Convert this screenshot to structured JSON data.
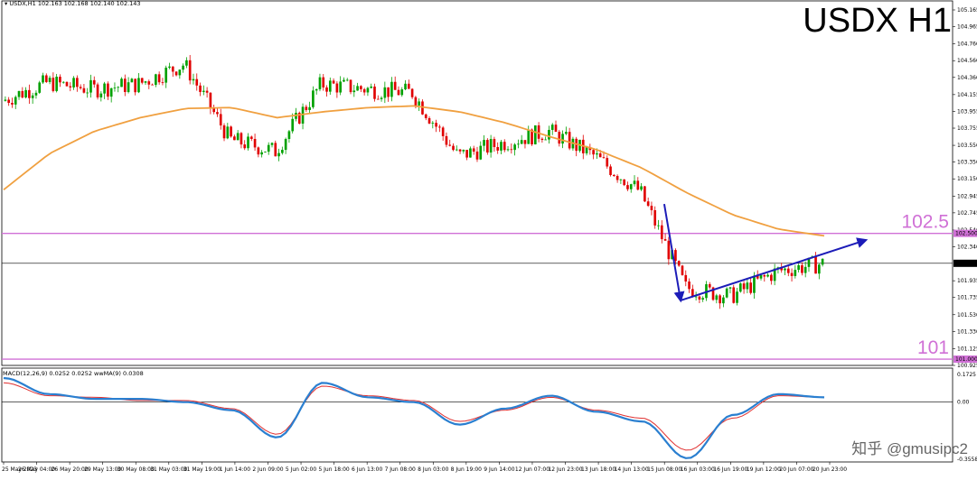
{
  "header": {
    "symbol_line": "USDX,H1  102.163 102.168 102.140 102.143",
    "macd_line": "MACD(12,26,9) 0.0252 0.0252  wwMA(9) 0.0308"
  },
  "title": "USDX H1",
  "watermark": "知乎 @gmusipc2",
  "price_axis": {
    "labels": [
      "105.165",
      "104.965",
      "104.760",
      "104.560",
      "104.360",
      "104.155",
      "103.955",
      "103.755",
      "103.550",
      "103.350",
      "103.150",
      "102.945",
      "102.745",
      "102.540",
      "102.340",
      "101.935",
      "101.735",
      "101.530",
      "101.330",
      "101.125",
      "100.925"
    ],
    "current_price": "102.143",
    "level_tags": [
      "102.500",
      "101.000"
    ]
  },
  "macd_axis": {
    "labels": [
      "0.1725",
      "0.00",
      "-0.3558"
    ]
  },
  "time_axis": [
    "25 May 2023",
    "26 May 04:00",
    "26 May 20:00",
    "29 May 13:00",
    "30 May 08:00",
    "31 May 03:00",
    "31 May 19:00",
    "1 Jun 14:00",
    "2 Jun 09:00",
    "5 Jun 02:00",
    "5 Jun 18:00",
    "6 Jun 13:00",
    "7 Jun 08:00",
    "8 Jun 03:00",
    "8 Jun 19:00",
    "9 Jun 14:00",
    "12 Jun 07:00",
    "12 Jun 23:00",
    "13 Jun 18:00",
    "14 Jun 13:00",
    "15 Jun 08:00",
    "16 Jun 03:00",
    "16 Jun 19:00",
    "19 Jun 12:00",
    "20 Jun 07:00",
    "20 Jun 23:00"
  ],
  "levels": [
    {
      "label": "102.5",
      "price": 102.5
    },
    {
      "label": "101",
      "price": 101.0
    }
  ],
  "colors": {
    "bull": "#00a000",
    "bear": "#e00000",
    "ma": "#f0a040",
    "level": "#d070d6",
    "arrow": "#1c1cb8",
    "macd": "#2a7fd0",
    "signal": "#e03030"
  },
  "chart_data": {
    "type": "line",
    "title": "USDX H1",
    "series": [
      {
        "name": "USDX,H1",
        "x": [
          "25 May",
          "26 May",
          "29 May",
          "30 May",
          "31 May",
          "1 Jun",
          "2 Jun",
          "5 Jun",
          "6 Jun",
          "7 Jun",
          "8 Jun",
          "9 Jun",
          "12 Jun",
          "13 Jun",
          "14 Jun",
          "15 Jun",
          "16 Jun",
          "19 Jun",
          "20 Jun"
        ],
        "values": [
          104.08,
          104.3,
          104.22,
          104.28,
          104.52,
          103.62,
          103.48,
          104.28,
          104.22,
          104.18,
          103.42,
          103.58,
          103.72,
          103.42,
          103.0,
          101.85,
          101.75,
          102.05,
          102.14
        ]
      },
      {
        "values": [
          103.02,
          103.45,
          103.72,
          103.88,
          103.99,
          104.0,
          103.88,
          103.95,
          104.0,
          104.02,
          103.95,
          103.82,
          103.65,
          103.5,
          103.28,
          102.98,
          102.72,
          102.55,
          102.47
        ]
      }
    ],
    "levels": [
      102.5,
      101.0
    ],
    "current_price": 102.143,
    "ylim": [
      100.925,
      105.165
    ],
    "macd": {
      "header": "MACD(12,26,9) 0.0252 0.0252 wwMA(9) 0.0308",
      "main": [
        0.15,
        0.05,
        0.02,
        0.02,
        0.0,
        -0.05,
        -0.22,
        0.12,
        0.03,
        0.0,
        -0.14,
        -0.04,
        0.04,
        -0.06,
        -0.12,
        -0.35,
        -0.08,
        0.05,
        0.03
      ],
      "signal": [
        0.12,
        0.04,
        0.03,
        0.01,
        0.01,
        -0.04,
        -0.2,
        0.1,
        0.04,
        0.01,
        -0.12,
        -0.05,
        0.03,
        -0.05,
        -0.1,
        -0.3,
        -0.1,
        0.04,
        0.03
      ],
      "ylim": [
        -0.3558,
        0.1725
      ]
    }
  }
}
